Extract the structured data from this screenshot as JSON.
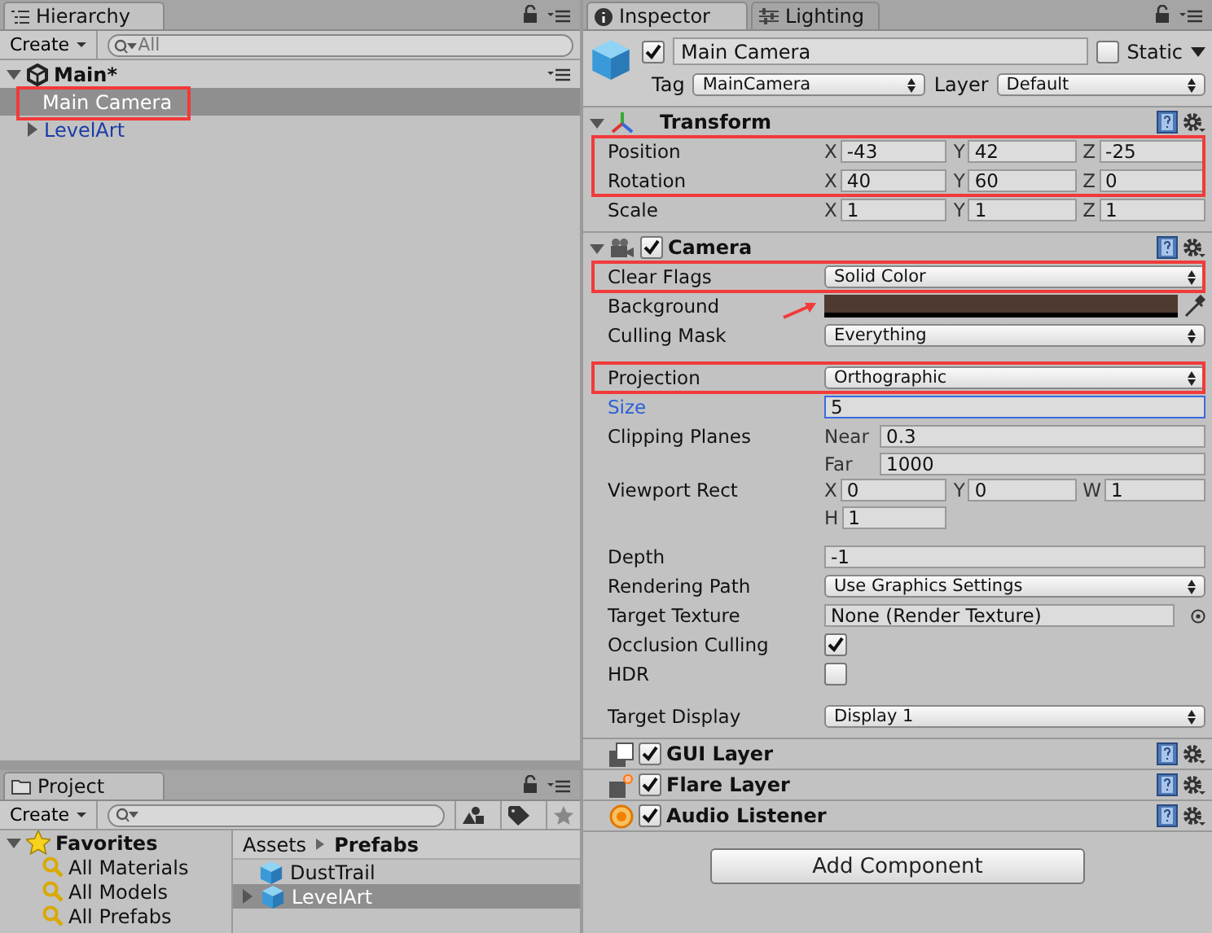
{
  "hierarchy": {
    "tabs": [
      {
        "label": "Hierarchy",
        "selected": true
      }
    ],
    "create": "Create",
    "search": {
      "placeholder": "All"
    },
    "scene": {
      "name": "Main*",
      "expanded": true,
      "children": [
        {
          "label": "Main Camera",
          "kind": "object",
          "selected": true,
          "highlighted": true
        },
        {
          "label": "LevelArt",
          "kind": "prefab",
          "selected": false,
          "highlighted": false,
          "expanded": false
        }
      ]
    }
  },
  "project": {
    "tabs": [
      {
        "label": "Project",
        "selected": true
      }
    ],
    "create": "Create",
    "favorites": {
      "label": "Favorites",
      "expanded": true,
      "items": [
        {
          "label": "All Materials"
        },
        {
          "label": "All Models"
        },
        {
          "label": "All Prefabs"
        }
      ]
    },
    "breadcrumb": [
      "Assets",
      "Prefabs"
    ],
    "assets": [
      {
        "label": "DustTrail",
        "selected": false
      },
      {
        "label": "LevelArt",
        "selected": true,
        "expanded": false
      }
    ]
  },
  "inspector": {
    "tabs": [
      {
        "label": "Inspector",
        "selected": true
      },
      {
        "label": "Lighting",
        "selected": false
      }
    ],
    "object": {
      "active": true,
      "name": "Main Camera",
      "static_label": "Static",
      "static": false,
      "tag_label": "Tag",
      "tag": "MainCamera",
      "layer_label": "Layer",
      "layer": "Default"
    },
    "components": [
      {
        "kind": "transform",
        "title": "Transform",
        "expanded": true,
        "groups": [
          [
            {
              "kind": "vector",
              "label": "Position",
              "highlighted": true,
              "values": [
                {
                  "axis": "X",
                  "value": "-43"
                },
                {
                  "axis": "Y",
                  "value": "42"
                },
                {
                  "axis": "Z",
                  "value": "-25"
                }
              ]
            },
            {
              "kind": "vector",
              "label": "Rotation",
              "highlighted": true,
              "values": [
                {
                  "axis": "X",
                  "value": "40"
                },
                {
                  "axis": "Y",
                  "value": "60"
                },
                {
                  "axis": "Z",
                  "value": "0"
                }
              ]
            },
            {
              "kind": "vector",
              "label": "Scale",
              "highlighted": false,
              "values": [
                {
                  "axis": "X",
                  "value": "1"
                },
                {
                  "axis": "Y",
                  "value": "1"
                },
                {
                  "axis": "Z",
                  "value": "1"
                }
              ]
            }
          ]
        ]
      },
      {
        "kind": "camera",
        "title": "Camera",
        "expanded": true,
        "enabled": true,
        "groups": [
          [
            {
              "kind": "dropdown",
              "label": "Clear Flags",
              "value": "Solid Color",
              "highlighted": true
            },
            {
              "kind": "color",
              "label": "Background",
              "color": "#4e3a30",
              "highlighted": false,
              "arrow": true
            },
            {
              "kind": "dropdown",
              "label": "Culling Mask",
              "value": "Everything",
              "highlighted": false
            }
          ],
          [
            {
              "kind": "dropdown",
              "label": "Projection",
              "value": "Orthographic",
              "highlighted": true
            },
            {
              "kind": "field",
              "label": "Size",
              "value": "5",
              "focused": true,
              "highlighted": false
            },
            {
              "kind": "pairs",
              "label": "Clipping Planes",
              "highlighted": false,
              "values": [
                {
                  "axis": "Near",
                  "value": "0.3"
                },
                {
                  "axis": "Far",
                  "value": "1000"
                }
              ]
            },
            {
              "kind": "grid",
              "label": "Viewport Rect",
              "highlighted": false,
              "values": [
                {
                  "axis": "X",
                  "value": "0"
                },
                {
                  "axis": "Y",
                  "value": "0"
                },
                {
                  "axis": "W",
                  "value": "1"
                },
                {
                  "axis": "H",
                  "value": "1"
                }
              ]
            }
          ],
          [
            {
              "kind": "field",
              "label": "Depth",
              "value": "-1",
              "focused": false,
              "highlighted": false
            },
            {
              "kind": "dropdown",
              "label": "Rendering Path",
              "value": "Use Graphics Settings",
              "highlighted": false
            },
            {
              "kind": "object",
              "label": "Target Texture",
              "value": "None (Render Texture)",
              "highlighted": false
            },
            {
              "kind": "checkbox",
              "label": "Occlusion Culling",
              "checked": true,
              "highlighted": false
            },
            {
              "kind": "checkbox",
              "label": "HDR",
              "checked": false,
              "highlighted": false
            }
          ],
          [
            {
              "kind": "dropdown",
              "label": "Target Display",
              "value": "Display 1",
              "highlighted": false
            }
          ]
        ]
      },
      {
        "kind": "gui_layer",
        "title": "GUI Layer",
        "enabled": true
      },
      {
        "kind": "flare_layer",
        "title": "Flare Layer",
        "enabled": true
      },
      {
        "kind": "audio_listener",
        "title": "Audio Listener",
        "enabled": true
      }
    ],
    "add_component": "Add Component"
  }
}
